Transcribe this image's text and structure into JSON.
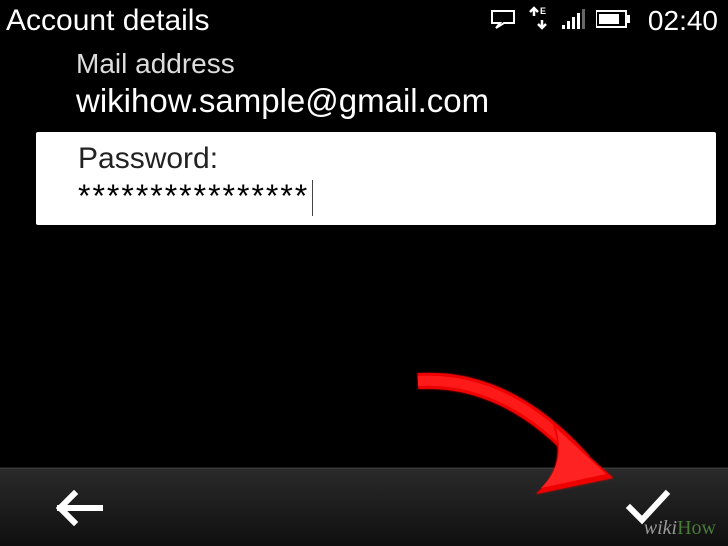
{
  "header": {
    "title": "Account details",
    "clock": "02:40",
    "data_indicator": "E"
  },
  "mail": {
    "label": "Mail address",
    "value": "wikihow.sample@gmail.com"
  },
  "password": {
    "label": "Password:",
    "value": "****************"
  },
  "watermark": {
    "wiki": "wiki",
    "how": "How"
  }
}
